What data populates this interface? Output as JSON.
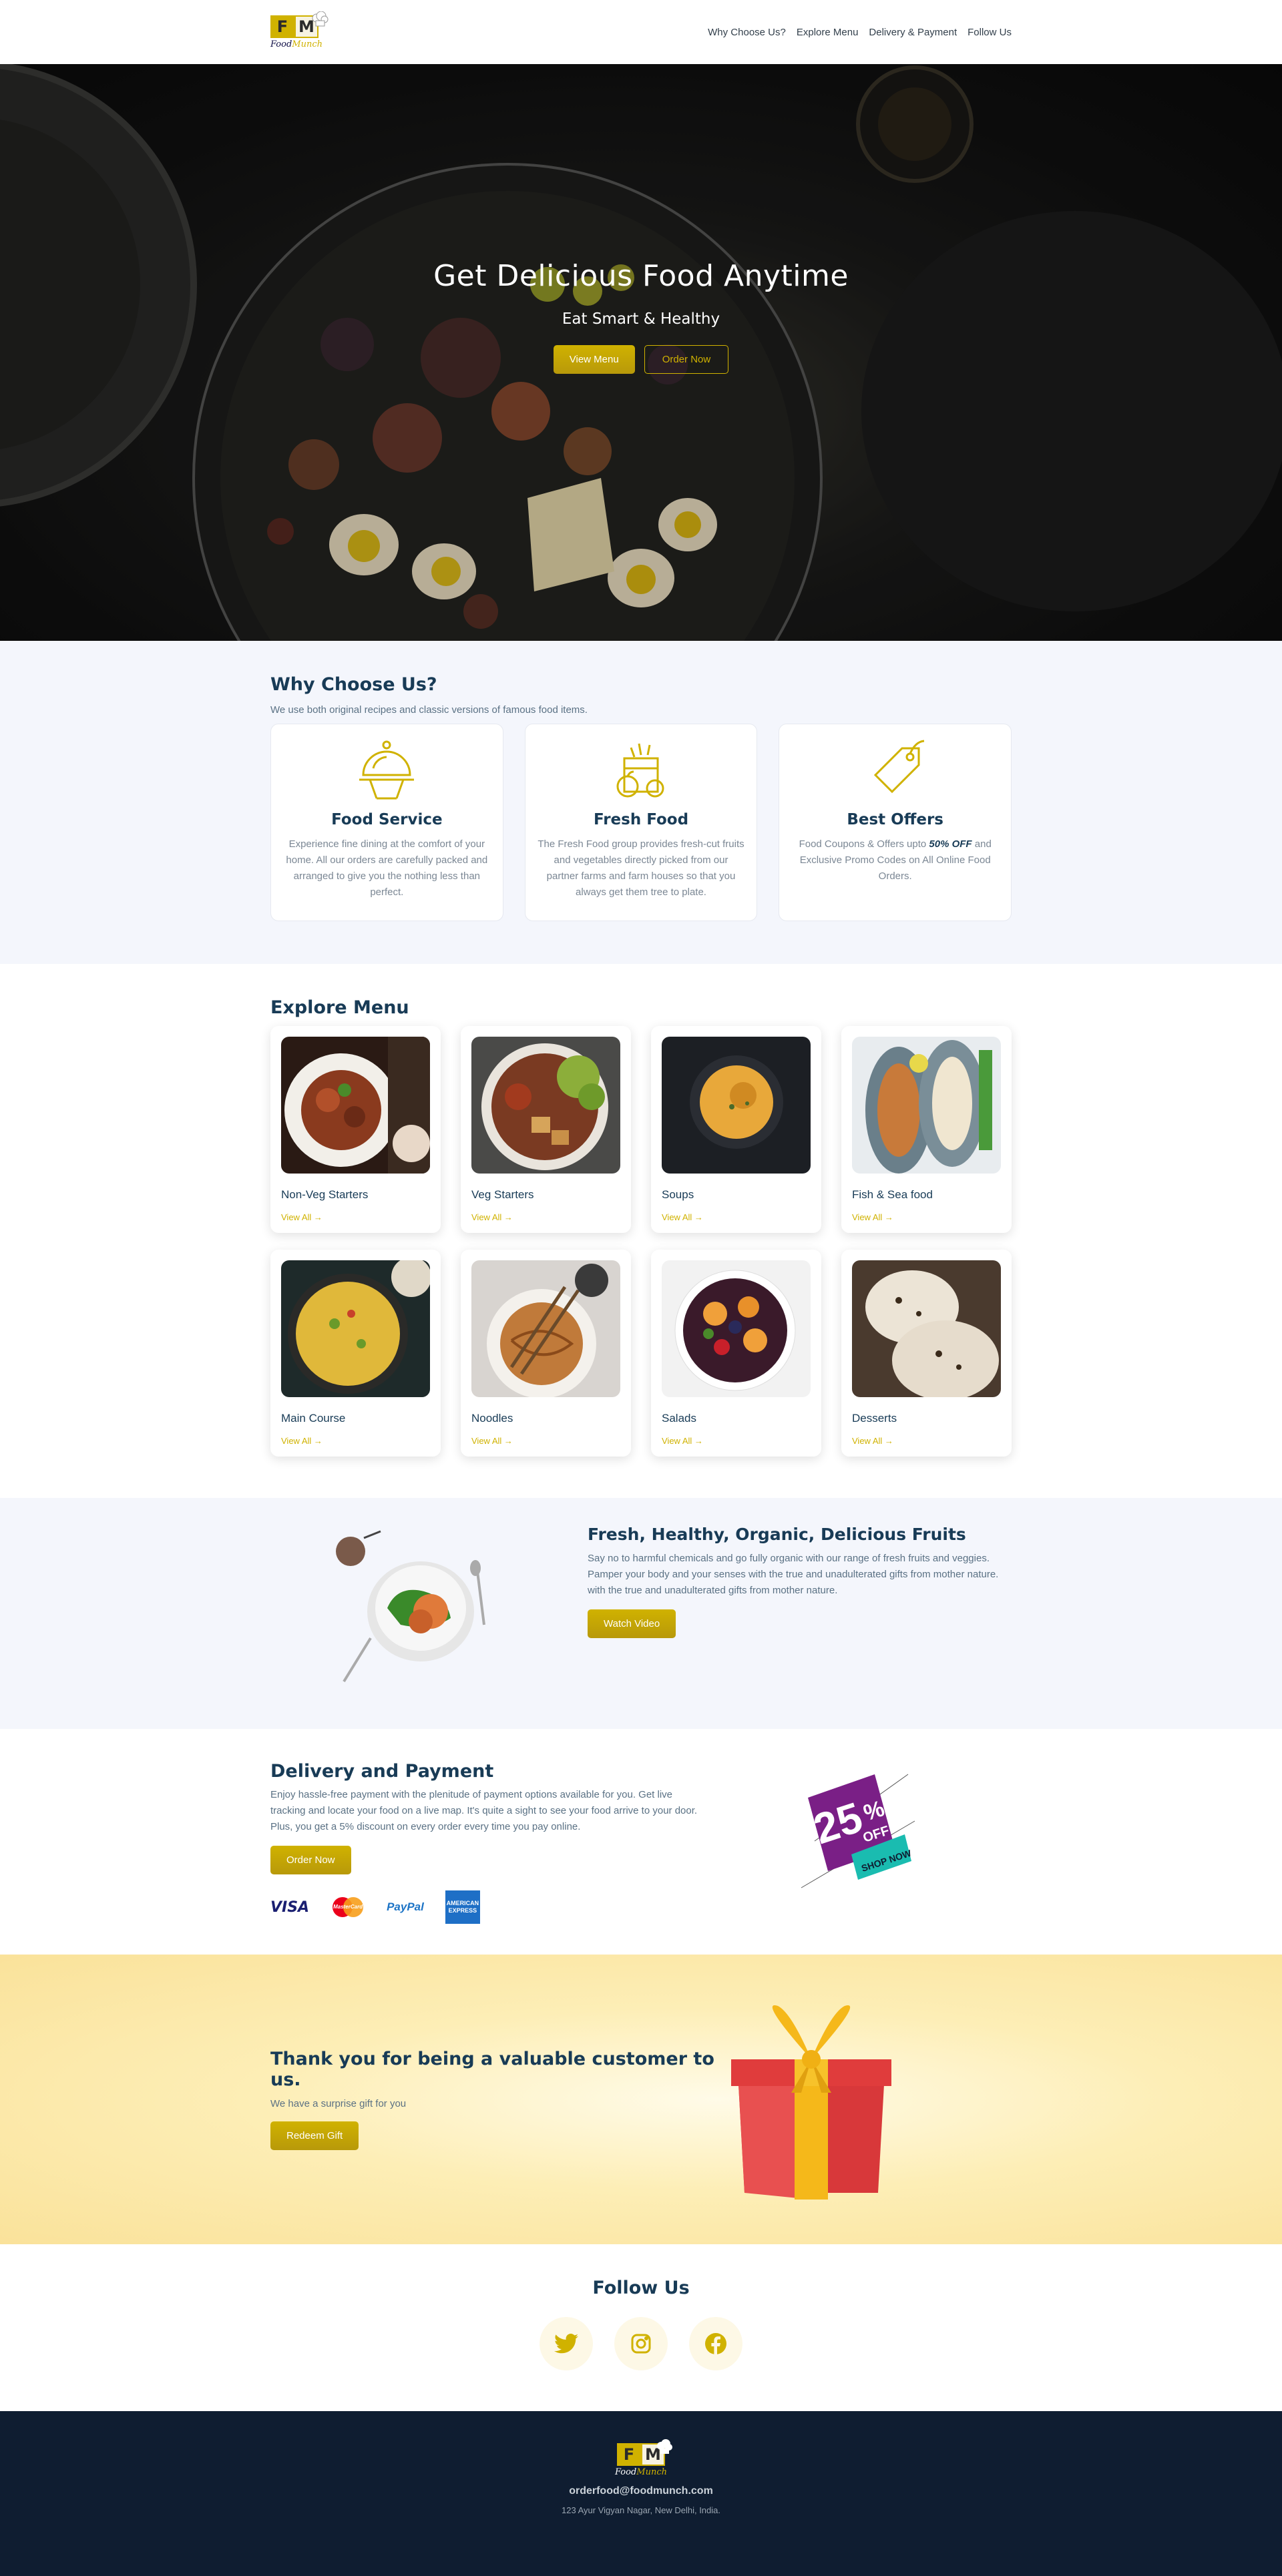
{
  "brand": {
    "logo_letters": [
      "F",
      "M"
    ],
    "name_part1": "Food",
    "name_part2": "Munch"
  },
  "nav": {
    "links": [
      "Why Choose Us?",
      "Explore Menu",
      "Delivery & Payment",
      "Follow Us"
    ]
  },
  "banner": {
    "heading": "Get Delicious Food Anytime",
    "caption": "Eat Smart & Healthy",
    "view_menu": "View Menu",
    "order_now": "Order Now"
  },
  "why": {
    "heading": "Why Choose Us?",
    "description": "We use both original recipes and classic versions of famous food items.",
    "cards": [
      {
        "icon": "food-service-icon",
        "title": "Food Service",
        "text": "Experience fine dining at the comfort of your home. All our orders are carefully packed and arranged to give you the nothing less than perfect."
      },
      {
        "icon": "fresh-food-icon",
        "title": "Fresh Food",
        "text": "The Fresh Food group provides fresh-cut fruits and vegetables directly picked from our partner farms and farm houses so that you always get them tree to plate."
      },
      {
        "icon": "price-tag-icon",
        "title": "Best Offers",
        "text_before": "Food Coupons & Offers upto ",
        "text_bold": "50% OFF",
        "text_after": " and Exclusive Promo Codes on All Online Food Orders."
      }
    ]
  },
  "menu": {
    "heading": "Explore Menu",
    "link_label": "View All →",
    "items": [
      {
        "title": "Non-Veg Starters"
      },
      {
        "title": "Veg Starters"
      },
      {
        "title": "Soups"
      },
      {
        "title": "Fish & Sea food"
      },
      {
        "title": "Main Course"
      },
      {
        "title": "Noodles"
      },
      {
        "title": "Salads"
      },
      {
        "title": "Desserts"
      }
    ]
  },
  "fruits": {
    "heading": "Fresh, Healthy, Organic, Delicious Fruits",
    "description": "Say no to harmful chemicals and go fully organic with our range of fresh fruits and veggies. Pamper your body and your senses with the true and unadulterated gifts from mother nature. with the true and unadulterated gifts from mother nature.",
    "button": "Watch Video"
  },
  "delivery": {
    "heading": "Delivery and Payment",
    "description": "Enjoy hassle-free payment with the plenitude of payment options available for you. Get live tracking and locate your food on a live map. It's quite a sight to see your food arrive to your door. Plus, you get a 5% discount on every order every time you pay online.",
    "button": "Order Now",
    "payments": {
      "visa": "VISA",
      "mastercard": "MasterCard",
      "paypal": "PayPal",
      "amex": "AMERICAN EXPRESS"
    },
    "badge": {
      "number": "25",
      "percent": "%",
      "off": "OFF",
      "shop": "SHOP NOW"
    }
  },
  "gift": {
    "heading": "Thank you for being a valuable customer to us.",
    "description": "We have a surprise gift for you",
    "button": "Redeem Gift"
  },
  "follow": {
    "heading": "Follow Us",
    "socials": [
      "twitter-icon",
      "instagram-icon",
      "facebook-icon"
    ]
  },
  "footer": {
    "email": "orderfood@foodmunch.com",
    "address": "123 Ayur Vigyan Nagar, New Delhi, India."
  },
  "colors": {
    "accent": "#d0b200",
    "heading": "#183b56",
    "footer_bg": "#0f1d31"
  }
}
